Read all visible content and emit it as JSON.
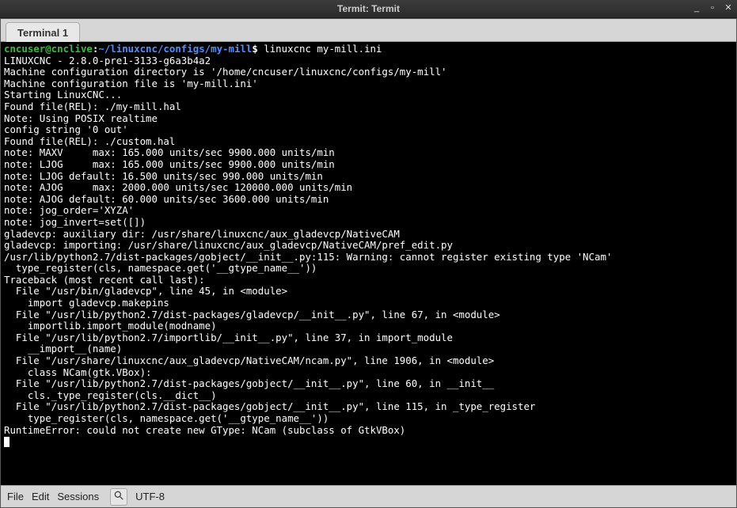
{
  "window": {
    "title": "Termit: Termit"
  },
  "tabs": [
    {
      "label": "Terminal 1"
    }
  ],
  "prompt": {
    "user": "cncuser@cnclive",
    "sep1": ":",
    "path": "~/linuxcnc/configs/my-mill",
    "sep2": "$ ",
    "cmd": "linuxcnc my-mill.ini"
  },
  "terminal_lines": [
    "LINUXCNC - 2.8.0-pre1-3133-g6a3b4a2",
    "Machine configuration directory is '/home/cncuser/linuxcnc/configs/my-mill'",
    "Machine configuration file is 'my-mill.ini'",
    "Starting LinuxCNC...",
    "Found file(REL): ./my-mill.hal",
    "Note: Using POSIX realtime",
    "config string '0 out'",
    "Found file(REL): ./custom.hal",
    "note: MAXV     max: 165.000 units/sec 9900.000 units/min",
    "note: LJOG     max: 165.000 units/sec 9900.000 units/min",
    "note: LJOG default: 16.500 units/sec 990.000 units/min",
    "note: AJOG     max: 2000.000 units/sec 120000.000 units/min",
    "note: AJOG default: 60.000 units/sec 3600.000 units/min",
    "note: jog_order='XYZA'",
    "note: jog_invert=set([])",
    "gladevcp: auxiliary dir: /usr/share/linuxcnc/aux_gladevcp/NativeCAM",
    "gladevcp: importing: /usr/share/linuxcnc/aux_gladevcp/NativeCAM/pref_edit.py",
    "/usr/lib/python2.7/dist-packages/gobject/__init__.py:115: Warning: cannot register existing type 'NCam'",
    "  type_register(cls, namespace.get('__gtype_name__'))",
    "Traceback (most recent call last):",
    "  File \"/usr/bin/gladevcp\", line 45, in <module>",
    "    import gladevcp.makepins",
    "  File \"/usr/lib/python2.7/dist-packages/gladevcp/__init__.py\", line 67, in <module>",
    "    importlib.import_module(modname)",
    "  File \"/usr/lib/python2.7/importlib/__init__.py\", line 37, in import_module",
    "    __import__(name)",
    "  File \"/usr/share/linuxcnc/aux_gladevcp/NativeCAM/ncam.py\", line 1906, in <module>",
    "    class NCam(gtk.VBox):",
    "  File \"/usr/lib/python2.7/dist-packages/gobject/__init__.py\", line 60, in __init__",
    "    cls._type_register(cls.__dict__)",
    "  File \"/usr/lib/python2.7/dist-packages/gobject/__init__.py\", line 115, in _type_register",
    "    type_register(cls, namespace.get('__gtype_name__'))",
    "RuntimeError: could not create new GType: NCam (subclass of GtkVBox)"
  ],
  "statusbar": {
    "file": "File",
    "edit": "Edit",
    "sessions": "Sessions",
    "encoding": "UTF-8"
  }
}
